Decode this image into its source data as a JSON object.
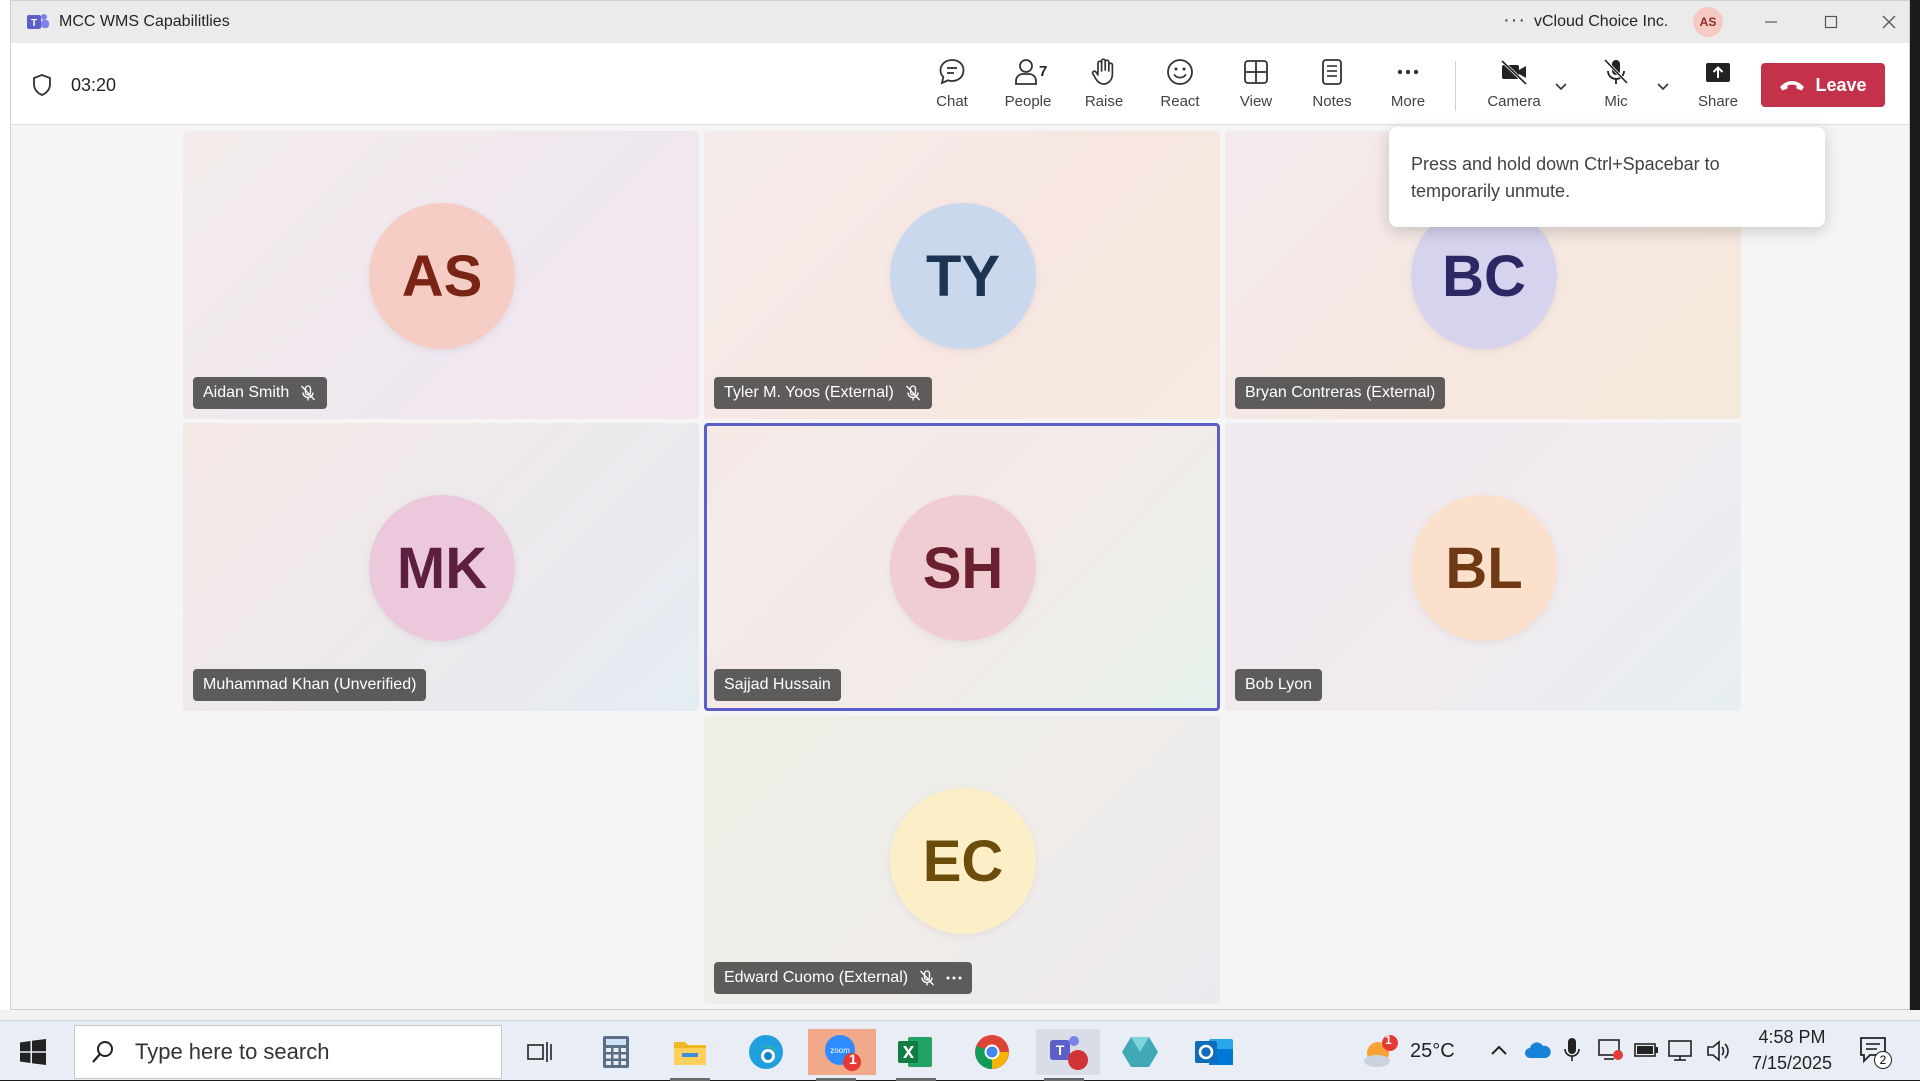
{
  "window": {
    "title": "MCC WMS Capabilitlies",
    "org": "vCloud Choice Inc.",
    "user_initials": "AS",
    "more_glyph": "···"
  },
  "meeting": {
    "timer": "03:20",
    "toolbar": {
      "chat": "Chat",
      "people": "People",
      "people_count": "7",
      "raise": "Raise",
      "react": "React",
      "view": "View",
      "notes": "Notes",
      "more": "More",
      "camera": "Camera",
      "mic": "Mic",
      "share": "Share",
      "leave": "Leave"
    },
    "tooltip": "Press and hold down Ctrl+Spacebar to temporarily unmute."
  },
  "participants": [
    {
      "initials": "AS",
      "name": "Aidan Smith",
      "muted": true,
      "bg": "#f5cdc4",
      "fg": "#7a2415"
    },
    {
      "initials": "TY",
      "name": "Tyler M. Yoos (External)",
      "muted": true,
      "bg": "#c9d8ec",
      "fg": "#1d3553"
    },
    {
      "initials": "BC",
      "name": "Bryan Contreras (External)",
      "muted": false,
      "bg": "#d6d3ee",
      "fg": "#2b2863"
    },
    {
      "initials": "MK",
      "name": "Muhammad Khan (Unverified)",
      "muted": false,
      "bg": "#ecc8dd",
      "fg": "#5c1f40"
    },
    {
      "initials": "SH",
      "name": "Sajjad Hussain",
      "muted": false,
      "bg": "#f0cdd2",
      "fg": "#6b2030"
    },
    {
      "initials": "BL",
      "name": "Bob Lyon",
      "muted": false,
      "bg": "#fbe1cc",
      "fg": "#6f3913"
    },
    {
      "initials": "EC",
      "name": "Edward Cuomo (External)",
      "muted": true,
      "bg": "#fcefc7",
      "fg": "#6b4c0b"
    }
  ],
  "taskbar": {
    "search_placeholder": "Type here to search",
    "weather": "25°C",
    "time": "4:58 PM",
    "date": "7/15/2025",
    "notif_count": "2",
    "zoom_badge": "1",
    "weather_badge": "1"
  }
}
